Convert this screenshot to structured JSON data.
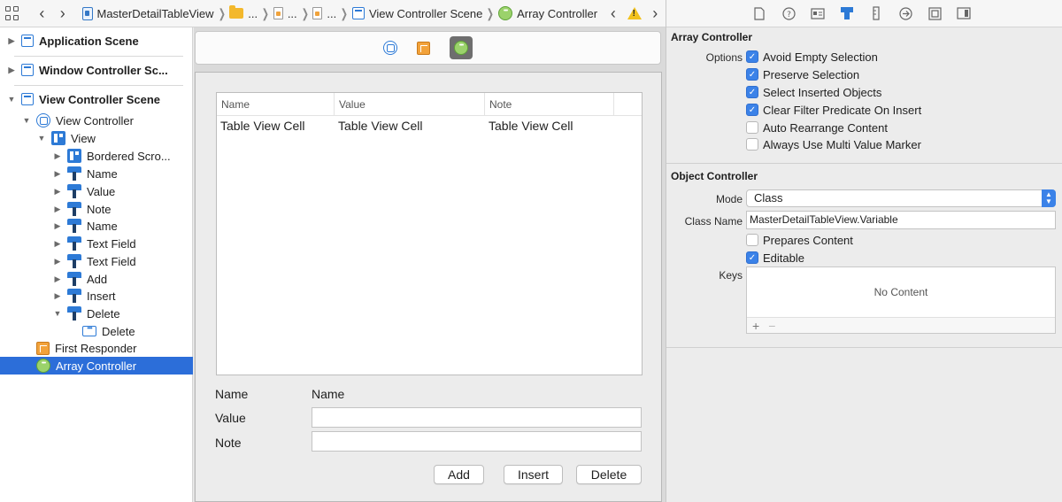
{
  "breadcrumb": {
    "items": [
      "MasterDetailTableView",
      "...",
      "...",
      "...",
      "View Controller Scene",
      "Array Controller"
    ]
  },
  "outline": {
    "rows": [
      {
        "label": "Application Scene"
      },
      {
        "label": "Window Controller Sc..."
      },
      {
        "label": "View Controller Scene"
      },
      {
        "label": "View Controller"
      },
      {
        "label": "View"
      },
      {
        "label": "Bordered Scro..."
      },
      {
        "label": "Name"
      },
      {
        "label": "Value"
      },
      {
        "label": "Note"
      },
      {
        "label": "Name"
      },
      {
        "label": "Text Field"
      },
      {
        "label": "Text Field"
      },
      {
        "label": "Add"
      },
      {
        "label": "Insert"
      },
      {
        "label": "Delete"
      },
      {
        "label": "Delete"
      },
      {
        "label": "First Responder"
      },
      {
        "label": "Array Controller"
      }
    ]
  },
  "canvas": {
    "table": {
      "columns": [
        "Name",
        "Value",
        "Note"
      ],
      "row": [
        "Table View Cell",
        "Table View Cell",
        "Table View Cell"
      ]
    },
    "form": {
      "name_label": "Name",
      "name_value": "Name",
      "value_label": "Value",
      "note_label": "Note"
    },
    "buttons": {
      "add": "Add",
      "insert": "Insert",
      "delete": "Delete"
    }
  },
  "inspector": {
    "array_controller": {
      "title": "Array Controller",
      "options_label": "Options",
      "options": [
        {
          "label": "Avoid Empty Selection",
          "checked": true
        },
        {
          "label": "Preserve Selection",
          "checked": true
        },
        {
          "label": "Select Inserted Objects",
          "checked": true
        },
        {
          "label": "Clear Filter Predicate On Insert",
          "checked": true
        },
        {
          "label": "Auto Rearrange Content",
          "checked": false
        },
        {
          "label": "Always Use Multi Value Marker",
          "checked": false
        }
      ]
    },
    "object_controller": {
      "title": "Object Controller",
      "mode_label": "Mode",
      "mode_value": "Class",
      "class_name_label": "Class Name",
      "class_name_value": "MasterDetailTableView.Variable",
      "prepares_content": {
        "label": "Prepares Content",
        "checked": false
      },
      "editable": {
        "label": "Editable",
        "checked": true
      },
      "keys_label": "Keys",
      "keys_empty": "No Content",
      "add_symbol": "+",
      "remove_symbol": "−"
    }
  },
  "colors": {
    "accent": "#2c6ed9",
    "warning": "#f2c21c",
    "array_controller_icon": "#9bd26b"
  }
}
